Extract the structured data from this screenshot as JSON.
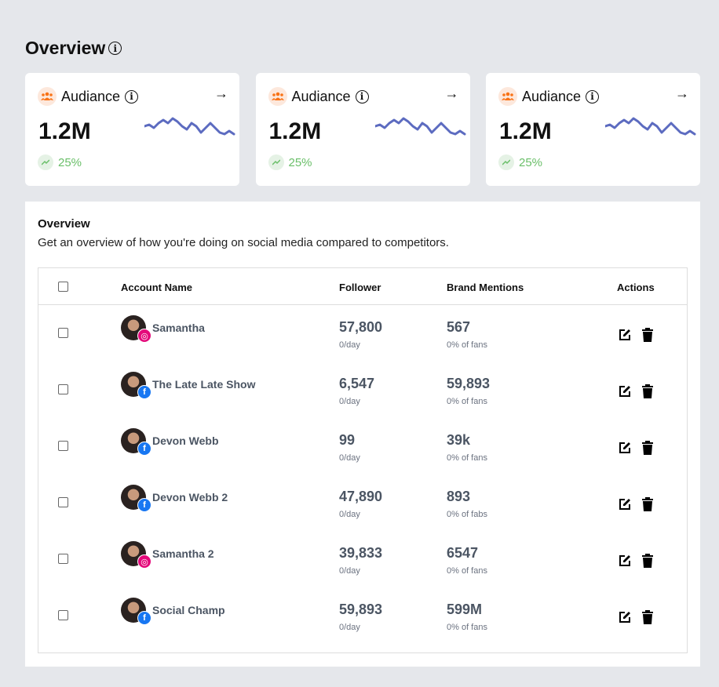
{
  "page": {
    "title": "Overview"
  },
  "cards": [
    {
      "label": "Audiance",
      "value": "1.2M",
      "trend": "25%"
    },
    {
      "label": "Audiance",
      "value": "1.2M",
      "trend": "25%"
    },
    {
      "label": "Audiance",
      "value": "1.2M",
      "trend": "25%"
    }
  ],
  "colors": {
    "accent": "#5c6bc0",
    "trend": "#6abf69",
    "audience_icon": "#f97316",
    "instagram": "#e4097a",
    "facebook": "#1877f2"
  },
  "panel": {
    "title": "Overview",
    "description": "Get an overview of how you're doing on social media compared to competitors."
  },
  "table": {
    "headers": {
      "account": "Account Name",
      "follower": "Follower",
      "mentions": "Brand Mentions",
      "actions": "Actions"
    },
    "rows": [
      {
        "name": "Samantha",
        "network": "instagram",
        "followers": "57,800",
        "followers_sub": "0/day",
        "mentions": "567",
        "mentions_sub": "0% of fans"
      },
      {
        "name": "The Late Late Show",
        "network": "facebook",
        "followers": "6,547",
        "followers_sub": "0/day",
        "mentions": "59,893",
        "mentions_sub": "0% of fans"
      },
      {
        "name": "Devon Webb",
        "network": "facebook",
        "followers": "99",
        "followers_sub": "0/day",
        "mentions": "39k",
        "mentions_sub": "0% of fans"
      },
      {
        "name": "Devon Webb 2",
        "network": "facebook",
        "followers": "47,890",
        "followers_sub": "0/day",
        "mentions": "893",
        "mentions_sub": "0% of fabs"
      },
      {
        "name": "Samantha 2",
        "network": "instagram",
        "followers": "39,833",
        "followers_sub": "0/day",
        "mentions": "6547",
        "mentions_sub": "0% of fans"
      },
      {
        "name": "Social Champ",
        "network": "facebook",
        "followers": "59,893",
        "followers_sub": "0/day",
        "mentions": "599M",
        "mentions_sub": "0% of fans"
      }
    ]
  }
}
